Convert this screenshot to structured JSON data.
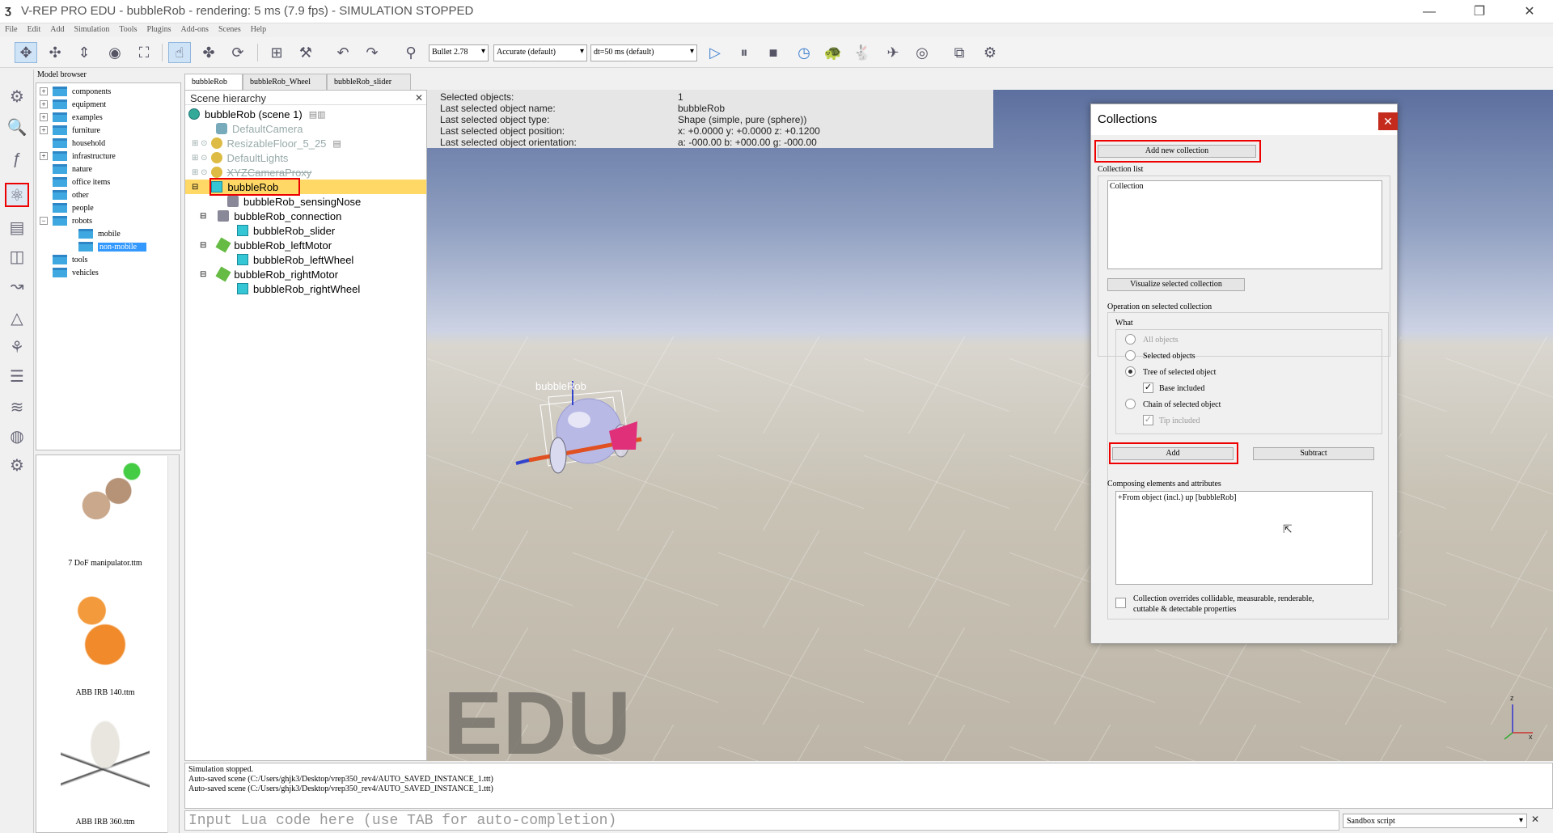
{
  "window": {
    "title": "V-REP PRO EDU - bubbleRob - rendering: 5 ms (7.9 fps) - SIMULATION STOPPED",
    "minimize": "—",
    "restore": "❐",
    "close": "✕"
  },
  "menu": [
    "File",
    "Edit",
    "Add",
    "Simulation",
    "Tools",
    "Plugins",
    "Add-ons",
    "Scenes",
    "Help"
  ],
  "toolbar": {
    "engine": "Bullet 2.78",
    "accuracy": "Accurate (default)",
    "timestep": "dt=50 ms (default)",
    "arrow": "▾"
  },
  "model_browser": {
    "title": "Model browser",
    "items": [
      {
        "label": "components"
      },
      {
        "label": "equipment"
      },
      {
        "label": "examples"
      },
      {
        "label": "furniture"
      },
      {
        "label": "household"
      },
      {
        "label": "infrastructure"
      },
      {
        "label": "nature"
      },
      {
        "label": "office items"
      },
      {
        "label": "other"
      },
      {
        "label": "people"
      },
      {
        "label": "robots"
      },
      {
        "label": "mobile"
      },
      {
        "label": "non-mobile"
      },
      {
        "label": "tools"
      },
      {
        "label": "vehicles"
      }
    ],
    "thumbnails": [
      {
        "label": "7 DoF manipulator.ttm"
      },
      {
        "label": "ABB IRB 140.ttm"
      },
      {
        "label": "ABB IRB 360.ttm"
      }
    ]
  },
  "tabs": [
    "bubbleRob",
    "bubbleRob_Wheel",
    "bubbleRob_slider"
  ],
  "hierarchy": {
    "title": "Scene hierarchy",
    "close": "✕",
    "items": [
      {
        "label": "bubbleRob (scene 1)"
      },
      {
        "label": "DefaultCamera"
      },
      {
        "label": "ResizableFloor_5_25"
      },
      {
        "label": "DefaultLights"
      },
      {
        "label": "XYZCameraProxy"
      },
      {
        "label": "bubbleRob"
      },
      {
        "label": "bubbleRob_sensingNose"
      },
      {
        "label": "bubbleRob_connection"
      },
      {
        "label": "bubbleRob_slider"
      },
      {
        "label": "bubbleRob_leftMotor"
      },
      {
        "label": "bubbleRob_leftWheel"
      },
      {
        "label": "bubbleRob_rightMotor"
      },
      {
        "label": "bubbleRob_rightWheel"
      }
    ]
  },
  "info": {
    "labels": [
      "Selected objects:",
      "Last selected object name:",
      "Last selected object type:",
      "Last selected object position:",
      "Last selected object orientation:"
    ],
    "values": [
      "1",
      "bubbleRob",
      "Shape (simple, pure (sphere))",
      "x: +0.0000    y: +0.0000    z: +0.1200",
      "a: -000.00    b: +000.00    g: -000.00"
    ]
  },
  "scene": {
    "watermark": "EDU",
    "robot_label": "bubbleRob",
    "axes": {
      "z": "z",
      "x": "x",
      "y": "y"
    }
  },
  "collections": {
    "title": "Collections",
    "close": "✕",
    "add_new": "Add new collection",
    "list_label": "Collection list",
    "list_header": "Collection",
    "visualize": "Visualize selected collection",
    "operation_label": "Operation on selected collection",
    "what_label": "What",
    "options": {
      "all_objects": "All objects",
      "selected_objects": "Selected objects",
      "tree": "Tree of selected object",
      "base_included": "Base included",
      "chain": "Chain of selected object",
      "tip_included": "Tip included"
    },
    "add": "Add",
    "subtract": "Subtract",
    "composing_label": "Composing elements and attributes",
    "composing_item": "+From object (incl.) up [bubbleRob]",
    "override_line1": "Collection overrides collidable, measurable, renderable,",
    "override_line2": "cuttable & detectable properties",
    "check": "✓"
  },
  "console": {
    "lines": [
      "Simulation stopped.",
      "Auto-saved scene (C:/Users/ghjk3/Desktop/vrep350_rev4/AUTO_SAVED_INSTANCE_1.ttt)",
      "Auto-saved scene (C:/Users/ghjk3/Desktop/vrep350_rev4/AUTO_SAVED_INSTANCE_1.ttt)"
    ],
    "input_placeholder": "Input Lua code here (use TAB for auto-completion)",
    "script_select": "Sandbox script",
    "close": "✕"
  },
  "colors": {
    "highlight_red": "#e00000",
    "selection_yellow": "#ffd866",
    "selection_blue": "#3399ff",
    "sky_top": "#5c6f9e",
    "floor": "#c9c3b6"
  }
}
